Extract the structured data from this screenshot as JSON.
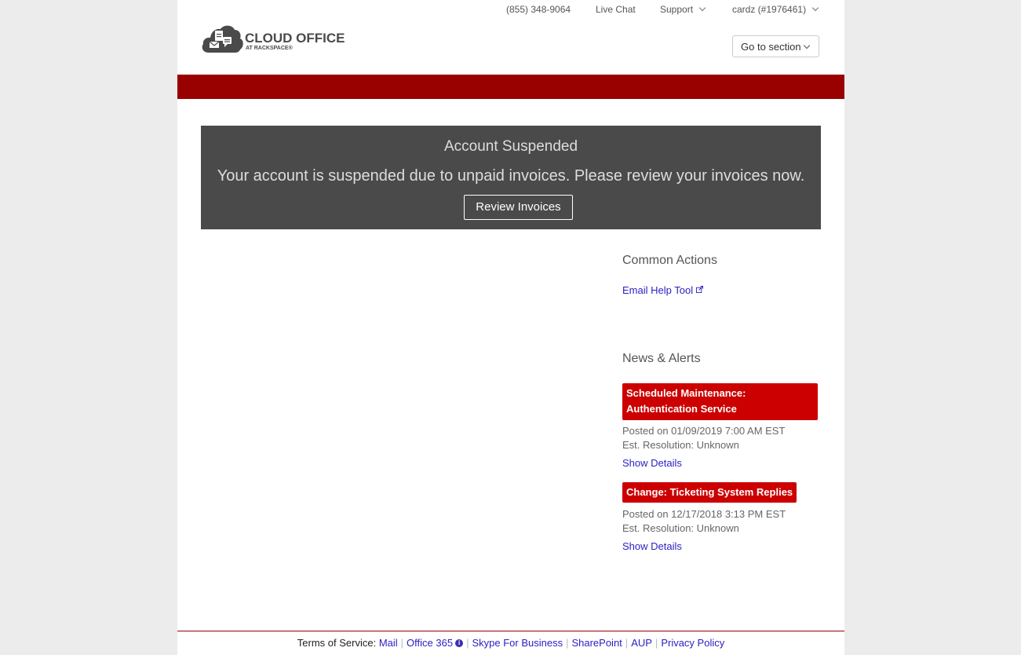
{
  "header": {
    "phone": "(855) 348-9064",
    "live_chat": "Live Chat",
    "support": "Support",
    "account": "cardz (#1976461)",
    "goto_section": "Go to section",
    "logo_main": "CLOUD OFFICE",
    "logo_sub": "AT RACKSPACE®"
  },
  "banner": {
    "title": "Account Suspended",
    "message": "Your account is suspended due to unpaid invoices. Please review your invoices now.",
    "button": "Review Invoices"
  },
  "common_actions": {
    "heading": "Common Actions",
    "email_help_tool": "Email Help Tool"
  },
  "news": {
    "heading": "News & Alerts",
    "items": [
      {
        "title": "Scheduled Maintenance: Authentication Service",
        "posted": "Posted on 01/09/2019 7:00 AM EST",
        "resolution": "Est. Resolution: Unknown",
        "details": "Show Details"
      },
      {
        "title": "Change: Ticketing System Replies",
        "posted": "Posted on 12/17/2018 3:13 PM EST",
        "resolution": "Est. Resolution: Unknown",
        "details": "Show Details"
      }
    ]
  },
  "footer": {
    "label": "Terms of Service:",
    "links": [
      "Mail",
      "Office 365",
      "Skype For Business",
      "SharePoint",
      "AUP",
      "Privacy Policy"
    ]
  },
  "colors": {
    "brand_red": "#990000",
    "alert_red": "#cc0000",
    "link": "#2a1fc2",
    "banner_bg": "#4a4a4a"
  }
}
